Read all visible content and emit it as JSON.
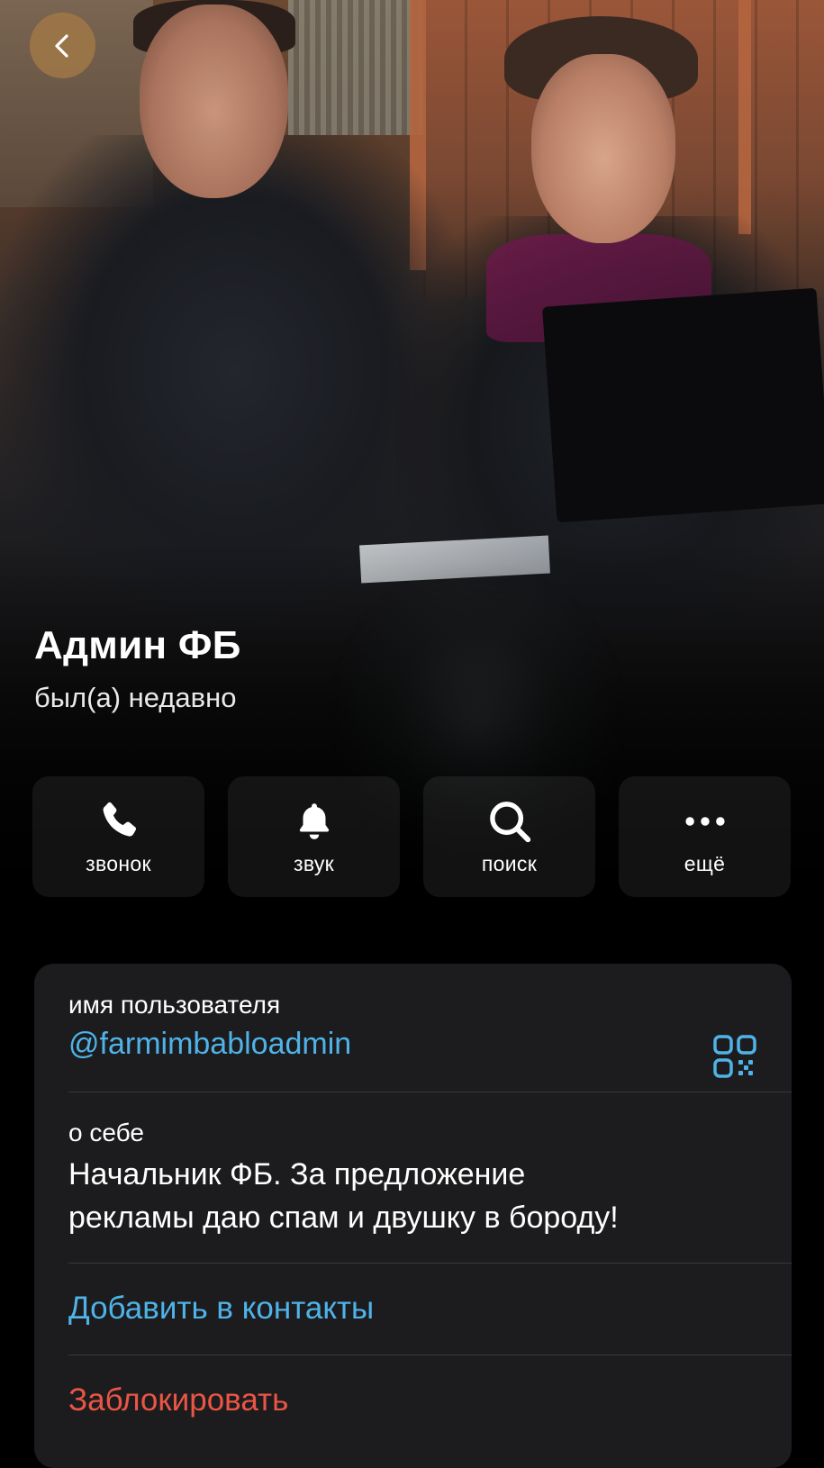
{
  "header": {
    "back_icon": "chevron-left-icon",
    "name": "Админ ФБ",
    "status": "был(а) недавно"
  },
  "actions": [
    {
      "label": "звонок",
      "icon": "phone-icon"
    },
    {
      "label": "звук",
      "icon": "bell-icon"
    },
    {
      "label": "поиск",
      "icon": "search-icon"
    },
    {
      "label": "ещё",
      "icon": "more-icon"
    }
  ],
  "info": {
    "username_caption": "имя пользователя",
    "username_value": "@farmimbabloadmin",
    "qr_icon": "qr-code-icon",
    "bio_caption": "о себе",
    "bio_line1": "Начальник ФБ. За предложение",
    "bio_line2": "рекламы даю спам и двушку в бороду!",
    "add_contact": "Добавить в контакты",
    "block": "Заблокировать"
  },
  "colors": {
    "accent_blue": "#4fb3e8",
    "danger_red": "#eb5545",
    "card_bg": "#1c1c1e",
    "back_button_bg": "#a07846"
  }
}
